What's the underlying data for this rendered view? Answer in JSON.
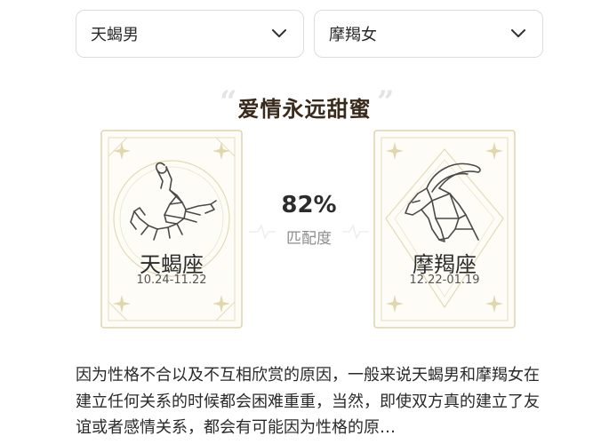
{
  "selectors": {
    "left": {
      "value": "天蝎男"
    },
    "right": {
      "value": "摩羯女"
    }
  },
  "headline": {
    "open_quote": "“",
    "text": "爱情永远甜蜜",
    "close_quote": "”"
  },
  "signs": {
    "left": {
      "name": "天蝎座",
      "dates": "10.24-11.22",
      "icon": "scorpion-icon"
    },
    "right": {
      "name": "摩羯座",
      "dates": "12.22-01.19",
      "icon": "goat-icon"
    }
  },
  "match": {
    "percent": "82%",
    "label": "匹配度"
  },
  "description": "因为性格不合以及不互相欣赏的原因，一般来说天蝎男和摩羯女在建立任何关系的时候都会困难重重，当然，即使双方真的建立了友谊或者感情关系，都会有可能因为性格的原…",
  "colors": {
    "card_line": "#d9cfa9",
    "card_bg": "#fdfcf6",
    "accent_text": "#3a2a1c",
    "muted": "#8d8d8d"
  }
}
